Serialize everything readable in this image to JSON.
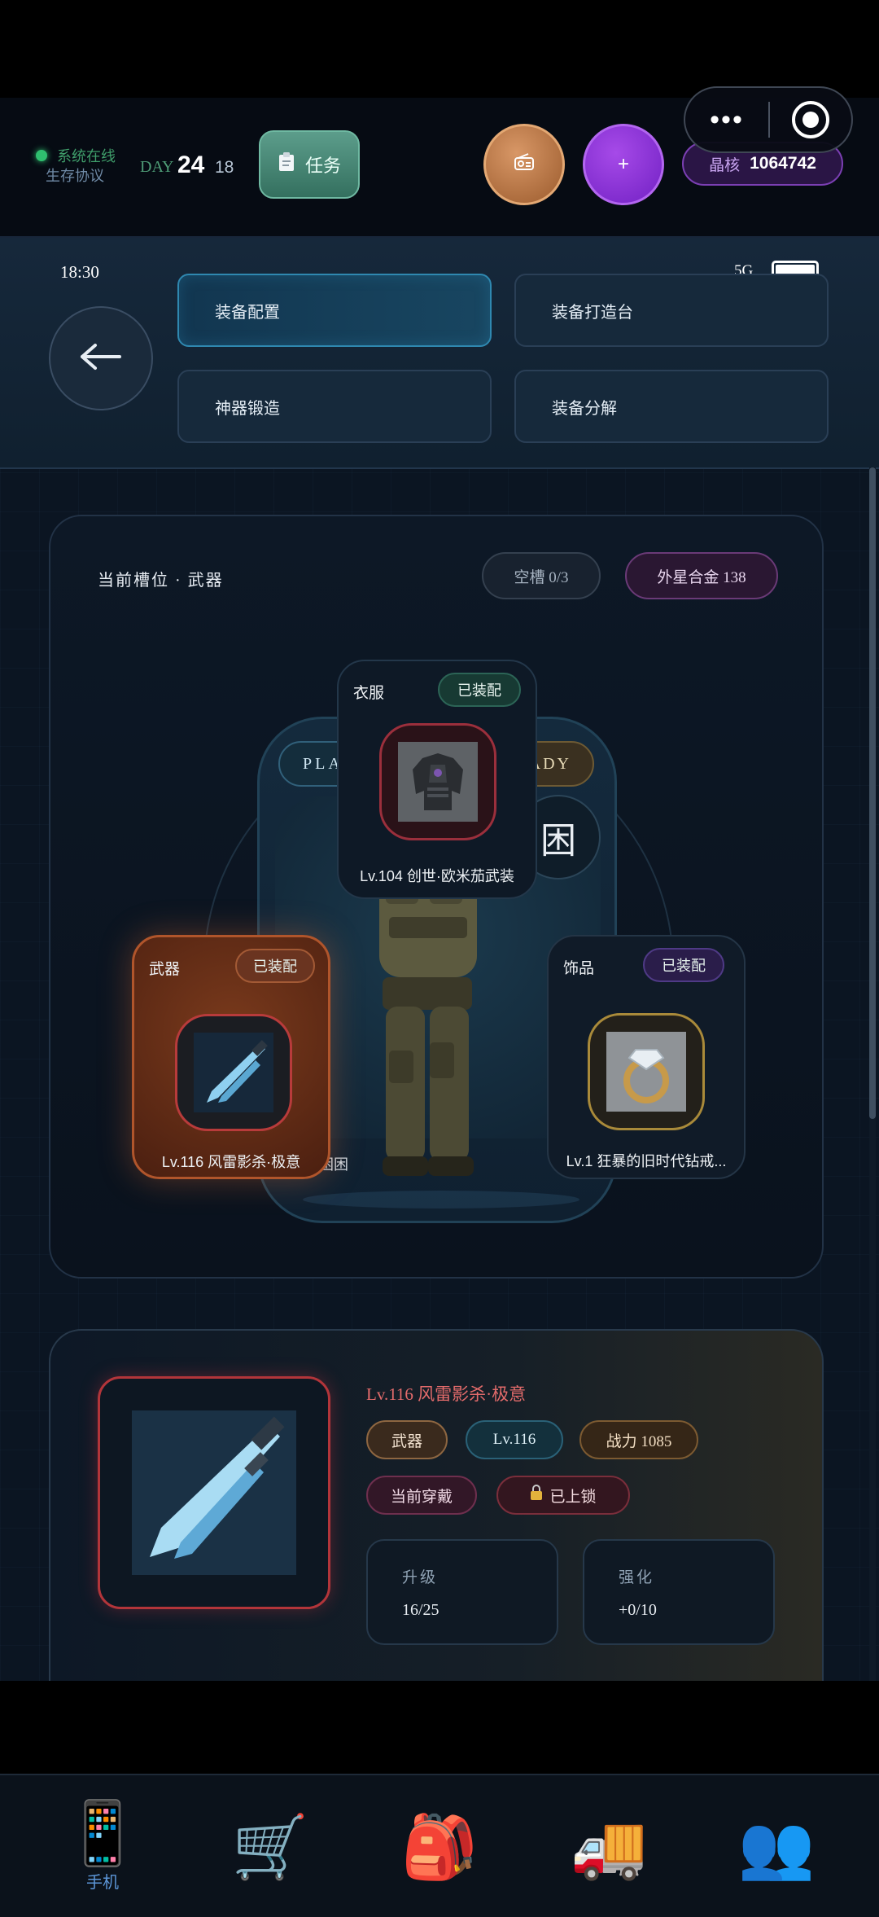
{
  "status_bar": {
    "online_text": "系统在线",
    "protocol_text": "生存协议",
    "day_label": "DAY",
    "day_value": "24",
    "day_sub": "18",
    "task_label": "任务",
    "task_icon": "clipboard-icon",
    "radio_icon": "radio-icon",
    "plus_label": "+",
    "core_label": "晶核",
    "core_value": "1064742"
  },
  "capsule": {
    "more_label": "•••",
    "close_icon": "target-icon"
  },
  "phone": {
    "time": "18:30",
    "network": "5G",
    "back_icon": "arrow-left-icon",
    "tabs": [
      {
        "label": "装备配置",
        "active": true
      },
      {
        "label": "装备打造台",
        "active": false
      },
      {
        "label": "神器锻造",
        "active": false
      },
      {
        "label": "装备分解",
        "active": false
      }
    ]
  },
  "slot_panel": {
    "title": "当前槽位 · 武器",
    "empty_pill": "空槽 0/3",
    "alloy_pill": "外星合金 138",
    "player_pill": "PLA",
    "ready_pill": "ADY",
    "sleep_badge": "困",
    "char_name": "困困",
    "slots": {
      "clothes": {
        "name": "衣服",
        "badge": "已装配",
        "caption": "Lv.104 创世·欧米茄武装"
      },
      "weapon": {
        "name": "武器",
        "badge": "已装配",
        "caption": "Lv.116 风雷影杀·极意"
      },
      "accessory": {
        "name": "饰品",
        "badge": "已装配",
        "caption": "Lv.1 狂暴的旧时代钻戒..."
      }
    }
  },
  "detail": {
    "name": "Lv.116 风雷影杀·极意",
    "tag_type": "武器",
    "tag_level": "Lv.116",
    "tag_power": "战力 1085",
    "tag_wearing": "当前穿戴",
    "tag_locked": "已上锁",
    "lock_icon": "lock-icon",
    "upgrade_label": "升级",
    "upgrade_value": "16/25",
    "enhance_label": "强化",
    "enhance_value": "+0/10"
  },
  "dock": [
    {
      "icon": "📱",
      "label": "手机"
    },
    {
      "icon": "🛒",
      "label": ""
    },
    {
      "icon": "🎒",
      "label": ""
    },
    {
      "icon": "🚚",
      "label": ""
    },
    {
      "icon": "👥",
      "label": ""
    }
  ],
  "colors": {
    "accent_teal": "#2f88b0",
    "weapon_orange": "#b0552b",
    "online_green": "#2fbf6f",
    "core_purple": "#7b3fb3",
    "detail_name_red": "#e36b6b"
  }
}
